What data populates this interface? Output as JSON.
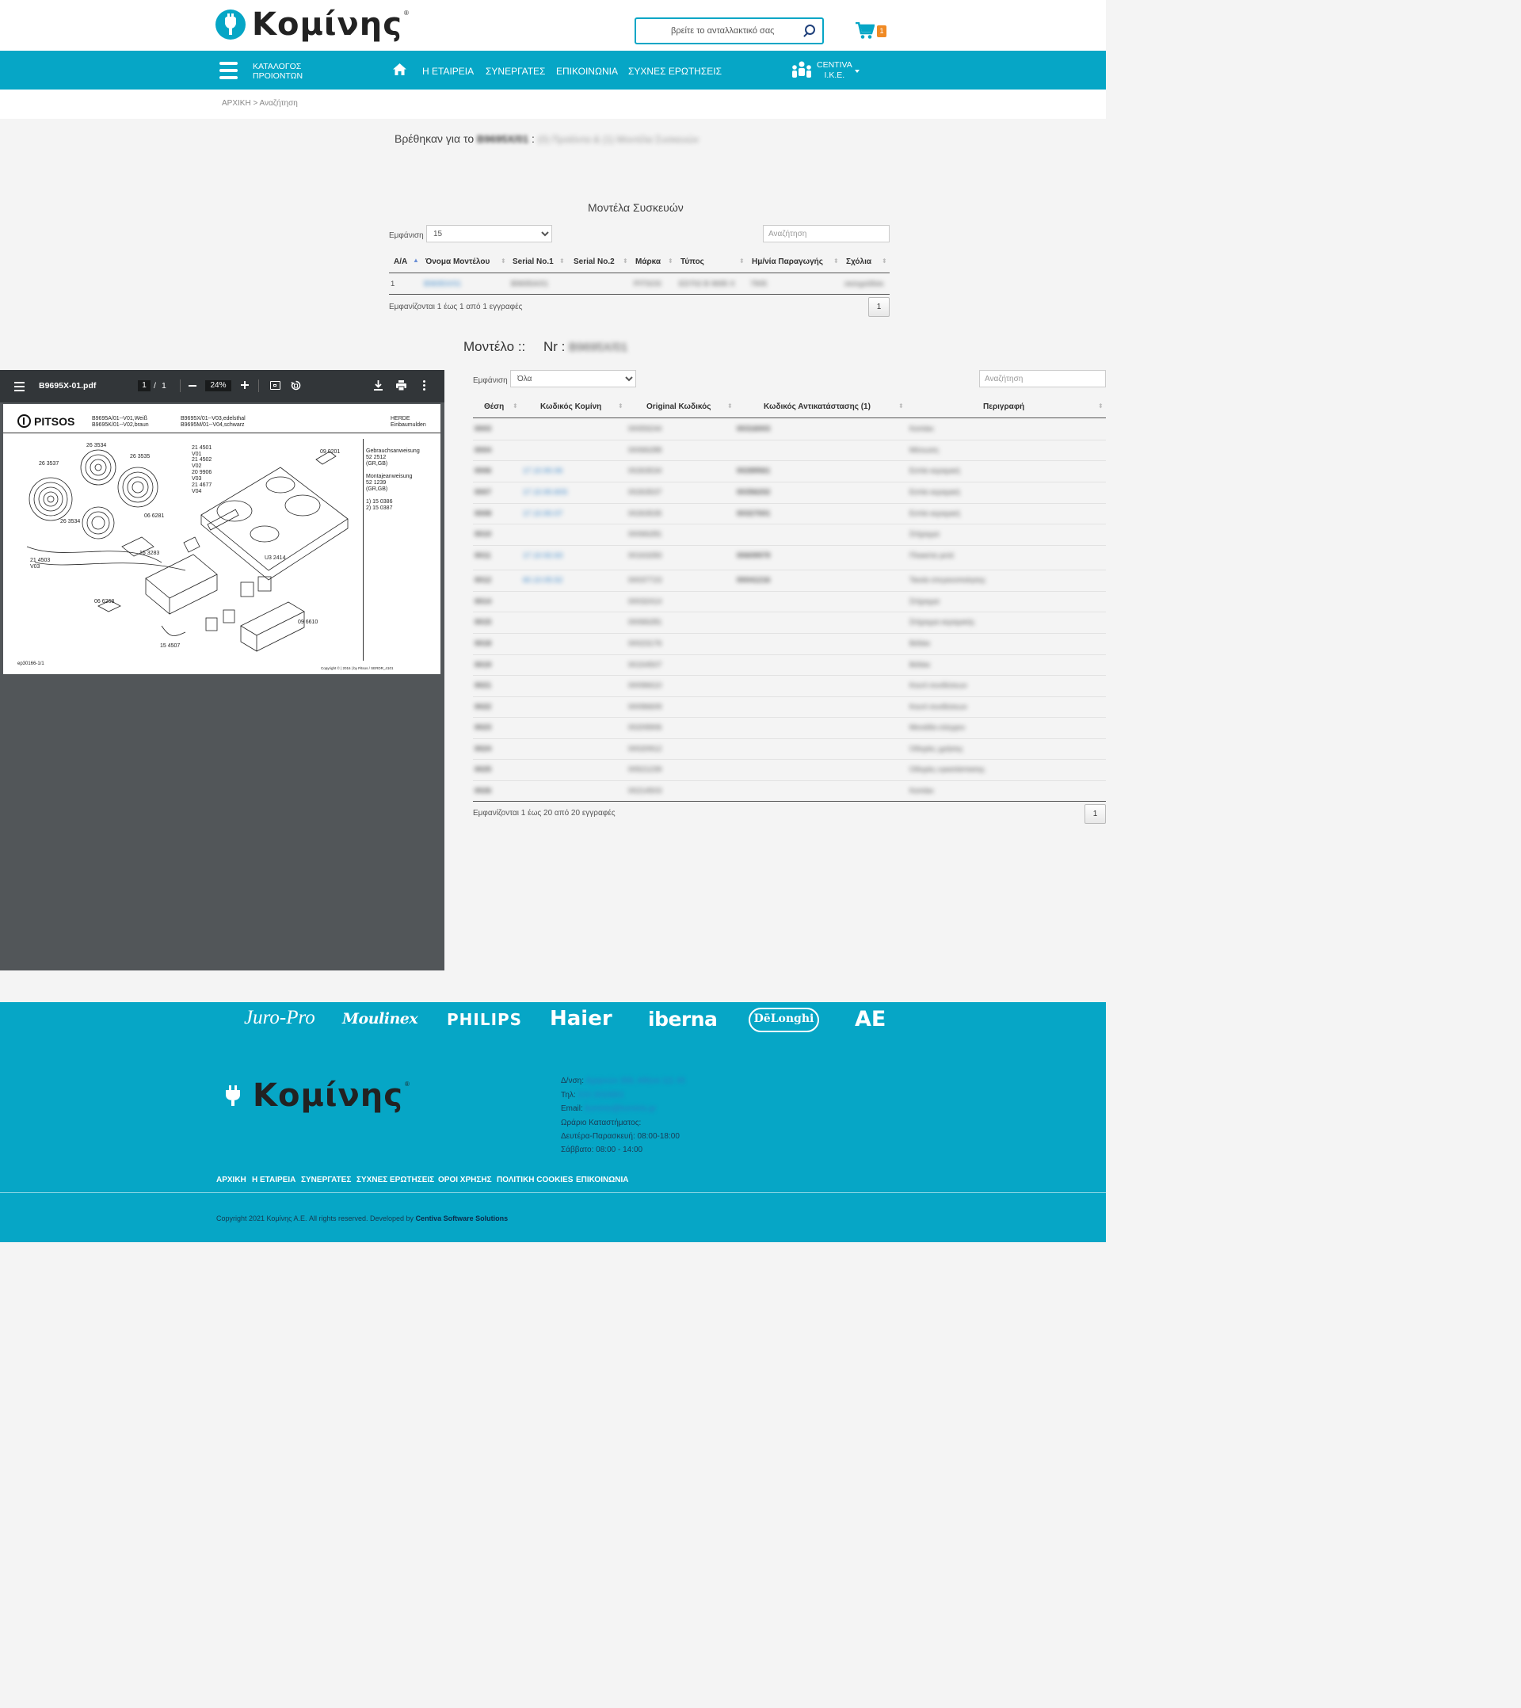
{
  "header": {
    "logo_text": "Κομίνης",
    "logo_reg": "®",
    "search_placeholder": "βρείτε το ανταλλακτικό σας",
    "cart_count": "1"
  },
  "nav": {
    "catalog_line1": "ΚΑΤΑΛΟΓΟΣ",
    "catalog_line2": "ΠΡΟΙΟΝΤΩΝ",
    "links": [
      "Η ΕΤΑΙΡΕΙΑ",
      "ΣΥΝΕΡΓΑΤΕΣ",
      "ΕΠΙΚΟΙΝΩΝΙΑ",
      "ΣΥΧΝΕΣ ΕΡΩΤΗΣΕΙΣ"
    ],
    "user_line1": "CENTIVA",
    "user_line2": "I.K.E."
  },
  "breadcrumb": "ΑΡΧΙΚΗ > Αναζήτηση",
  "results": {
    "prefix": "Βρέθηκαν για το",
    "query": "B9695X/01",
    "colon": ":",
    "summary": "(0) Προϊόντα & (1) Μοντέλα Συσκευών"
  },
  "models": {
    "title": "Μοντέλα Συσκευών",
    "show_label": "Εμφάνιση",
    "show_value": "15",
    "search_placeholder": "Αναζήτηση",
    "columns": [
      "Α/Α",
      "Όνομα Μοντέλου",
      "Serial No.1",
      "Serial No.2",
      "Μάρκα",
      "Τύπος",
      "Ημ/νία Παραγωγής",
      "Σχόλια"
    ],
    "row": [
      "1",
      "B9695X/01",
      "B9695A/01",
      "",
      "PITSOS",
      "ED702 B 9695 X",
      "7905",
      "σκληρόδίσκ"
    ],
    "info": "Εμφανίζονται 1 έως 1 από 1 εγγραφές",
    "page": "1"
  },
  "model_heading": {
    "label": "Μοντέλο ::",
    "nr_label": "Nr :",
    "nr_value": "B9695X/01"
  },
  "pdf": {
    "filename": "B9695X-01.pdf",
    "page_current": "1",
    "page_sep": "/",
    "page_total": "1",
    "zoom": "24%",
    "brand": "PITSOS",
    "models_left": [
      "B9695A/01--V01,Weiß",
      "B9695K/01--V02,braun"
    ],
    "models_right": [
      "B9695X/01--V03,edelsthal",
      "B9695M/01--V04,schwarz"
    ],
    "type_right": [
      "HERDE",
      "Einbaumulden"
    ],
    "docs": [
      "Gebrauchsanweisung",
      "52 2512",
      "(GR,GB)",
      "",
      "Montajeanweisung",
      "52 1239",
      "(GR,GB)",
      "",
      "1) 15 0386",
      "2) 15 0387"
    ],
    "part_labels": [
      "26 3534",
      "26 3537",
      "26 3535",
      "21 4501",
      "V01",
      "21 4502",
      "V02",
      "20 9906",
      "V03",
      "21 4677",
      "V04",
      "09 0201",
      "06 6281",
      "26 3534",
      "16 3283",
      "21 4503",
      "V03",
      "U3 2414",
      "06 6268",
      "15 4507",
      "09 6610"
    ],
    "footer_left": "ep30166-1/1",
    "footer_right": "Copyright © | 2016 | by Pitsos / SERDR_4101"
  },
  "parts": {
    "show_label": "Εμφάνιση",
    "show_value": "Όλα",
    "search_placeholder": "Αναζήτηση",
    "columns": [
      "Θέση",
      "Κωδικός Κομίνη",
      "Original Κωδικός",
      "Κωδικός Αντικατάστασης (1)",
      "Περιγραφή"
    ],
    "rows": [
      [
        "0003",
        "",
        "00059244",
        "00316003",
        "Καπάκι"
      ],
      [
        "0004",
        "",
        "00066288",
        "",
        "Μόνωση"
      ],
      [
        "0006",
        "17.10.90.06",
        "00263534",
        "00289561",
        "Εστία κεραμική"
      ],
      [
        "0007",
        "17.10.90.60S",
        "00263537",
        "00356202",
        "Εστία κεραμική"
      ],
      [
        "0008",
        "17.10.90.07",
        "00263535",
        "00327001",
        "Εστία κεραμική"
      ],
      [
        "0010",
        "",
        "00066281",
        "",
        "Στήριγμα"
      ],
      [
        "0011",
        "17.10.92.63",
        "00163283",
        "00609979",
        "Πλακέτα ρελέ"
      ],
      [
        "0012",
        "60.10.05.52",
        "00037723",
        "00041216",
        "Ταινία στεγανοποίησης"
      ],
      [
        "0014",
        "",
        "00032414",
        "",
        "Στήριγμα"
      ],
      [
        "0015",
        "",
        "00066281",
        "",
        "Στήριγμα κεραμικής"
      ],
      [
        "0018",
        "",
        "00023176",
        "",
        "Βιδάκι"
      ],
      [
        "0019",
        "",
        "00154507",
        "",
        "Βιδάκι"
      ],
      [
        "0021",
        "",
        "00096610",
        "",
        "Κουτί συνδέσεων"
      ],
      [
        "0022",
        "",
        "00096609",
        "",
        "Κουτί συνδέσεων"
      ],
      [
        "0023",
        "",
        "00209906",
        "",
        "Μονάδα ελέγχου"
      ],
      [
        "0024",
        "",
        "00020912",
        "",
        "Οδηγίες χρήσης"
      ],
      [
        "0025",
        "",
        "00521239",
        "",
        "Οδηγίες εγκατάστασης"
      ],
      [
        "0026",
        "",
        "00214503",
        "",
        "Καπάκι"
      ]
    ],
    "info": "Εμφανίζονται 1 έως 20 από 20 εγγραφές",
    "page": "1"
  },
  "brands": [
    "Juro-Pro",
    "Moulinex",
    "PHILIPS",
    "Haier",
    "iberna",
    "DēLonghi",
    "AE"
  ],
  "footer": {
    "logo_text": "Κομίνης",
    "address_label": "Δ/νση:",
    "address_value": "Αχαρνών 358, Αθήνα 111 45",
    "phone_label": "Τηλ:",
    "phone_value": "210 2010001",
    "email_label": "Email:",
    "email_value": "kominis@kominis.gr",
    "hours_title": "Ωράριο Καταστήματος:",
    "hours_weekday": "Δευτέρα-Παρασκευή: 08:00-18:00",
    "hours_saturday": "Σάββατο: 08:00 - 14:00",
    "links": [
      "ΑΡΧΙΚΗ",
      "Η ΕΤΑΙΡΕΙΑ",
      "ΣΥΝΕΡΓΑΤΕΣ",
      "ΣΥΧΝΕΣ ΕΡΩΤΗΣΕΙΣ",
      "ΟΡΟΙ ΧΡΗΣΗΣ",
      "ΠΟΛΙΤΙΚΗ COOKIES",
      "ΕΠΙΚΟΙΝΩΝΙΑ"
    ],
    "copyright": "Copyright 2021 Κομίνης Α.Ε. All rights reserved. Developed by",
    "developer": "Centiva Software Solutions"
  },
  "colors": {
    "brand": "#06a6c6",
    "accent": "#f08a24",
    "link": "#3a86c8",
    "pdf_toolbar": "#323639",
    "pdf_bg": "#525659"
  }
}
